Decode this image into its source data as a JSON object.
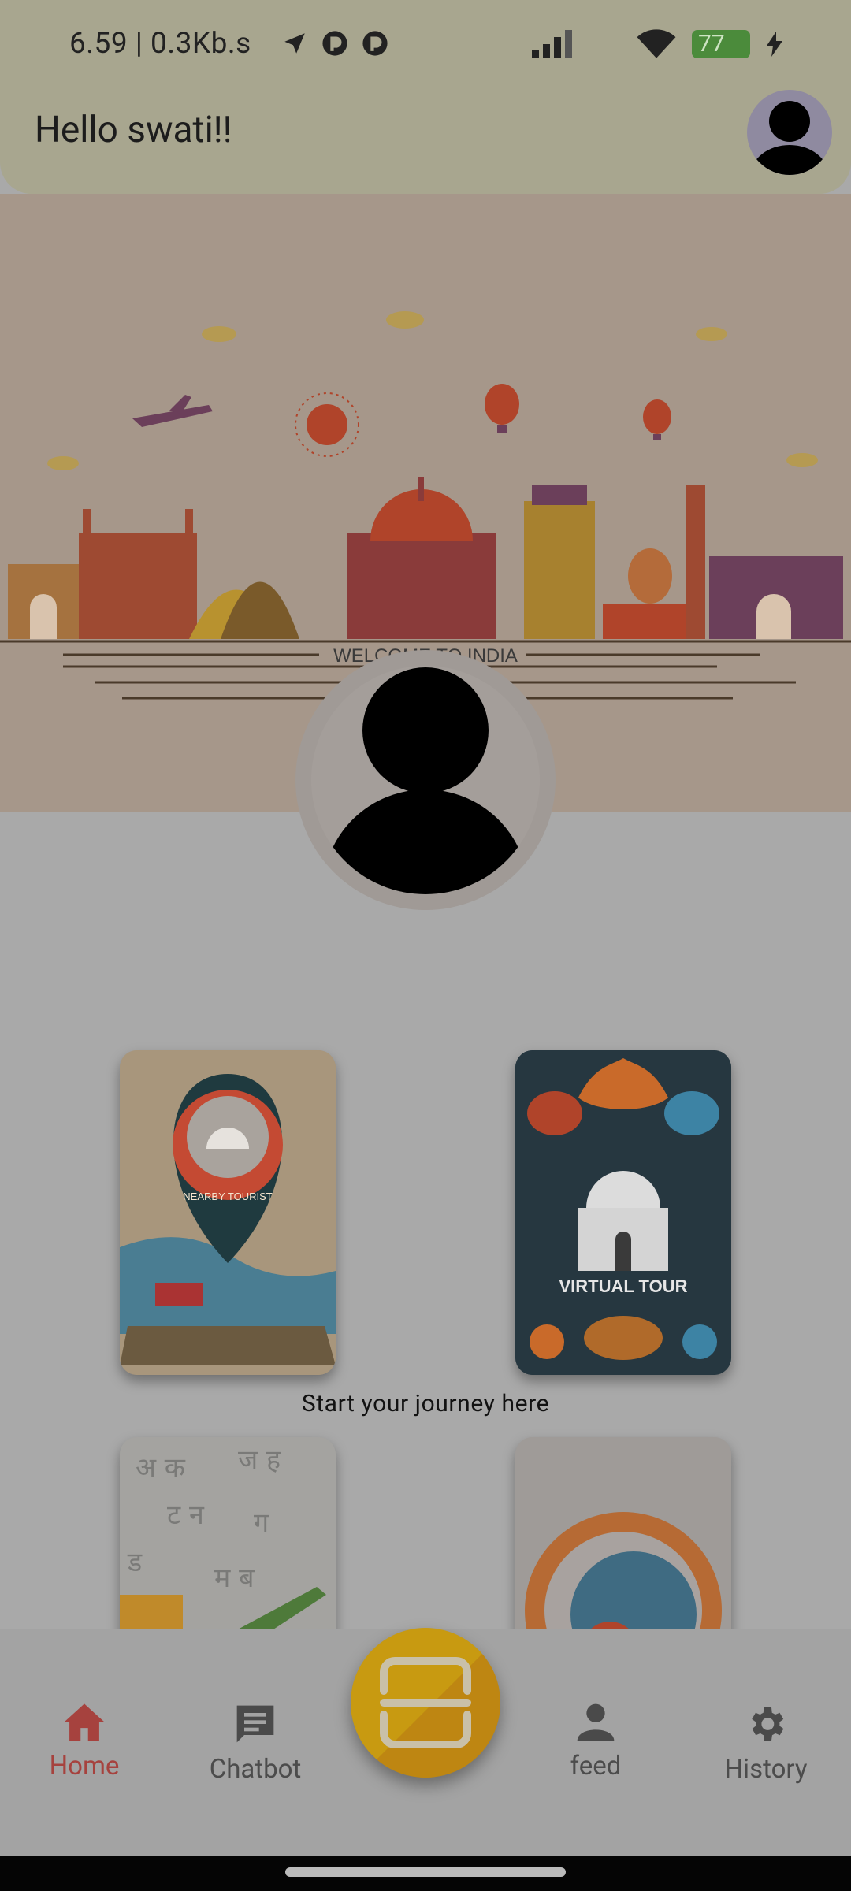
{
  "status_bar": {
    "time": "6.59 | 0.3Kb.s",
    "battery": "77",
    "icons": [
      "navigation-icon",
      "app-icon",
      "app-icon",
      "signal-icon",
      "wifi-icon",
      "battery-icon",
      "charging-icon"
    ]
  },
  "header": {
    "greeting": "Hello  swati!!",
    "avatar_icon": "person-icon"
  },
  "hero": {
    "banner_text": "WELCOME TO INDIA"
  },
  "cards": [
    {
      "name": "nearby-tourist",
      "label": "NEARBY TOURIST"
    },
    {
      "name": "virtual-tour",
      "label": "VIRTUAL TOUR"
    },
    {
      "name": "language",
      "label": ""
    },
    {
      "name": "globe",
      "label": ""
    }
  ],
  "caption": "Start your journey here",
  "nav": {
    "items": [
      {
        "label": "Home",
        "icon": "home-icon",
        "active": true
      },
      {
        "label": "Chatbot",
        "icon": "chat-icon",
        "active": false
      },
      {
        "label": "feed",
        "icon": "person-icon",
        "active": false
      },
      {
        "label": "History",
        "icon": "gear-icon",
        "active": false
      }
    ],
    "fab_icon": "scan-icon"
  },
  "colors": {
    "header_bg": "#a8a68f",
    "active_nav": "#a6423e",
    "fab": "#c89a11",
    "page_bg": "#a9a9a9"
  }
}
